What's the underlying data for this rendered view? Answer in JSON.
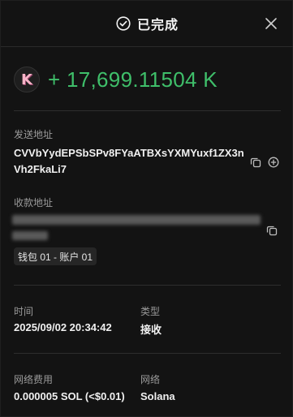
{
  "header": {
    "title": "已完成",
    "status_icon": "check-circle-icon",
    "close_icon": "close-icon"
  },
  "amount": {
    "token_icon": "token-k-logo",
    "text": "+ 17,699.11504 K",
    "color": "#3fbf6a"
  },
  "sender": {
    "label": "发送地址",
    "address": "CVVbYydEPSbSPv8FYaATBXsYXMYuxf1ZX3nVh2FkaLi7",
    "copy_icon": "copy-icon",
    "add_icon": "add-circle-icon"
  },
  "receiver": {
    "label": "收款地址",
    "copy_icon": "copy-icon",
    "wallet_tag": "钱包 01 - 账户 01"
  },
  "details": {
    "time_label": "时间",
    "time_value": "2025/09/02 20:34:42",
    "type_label": "类型",
    "type_value": "接收",
    "fee_label": "网络费用",
    "fee_value": "0.000005 SOL (<$0.01)",
    "network_label": "网络",
    "network_value": "Solana"
  }
}
